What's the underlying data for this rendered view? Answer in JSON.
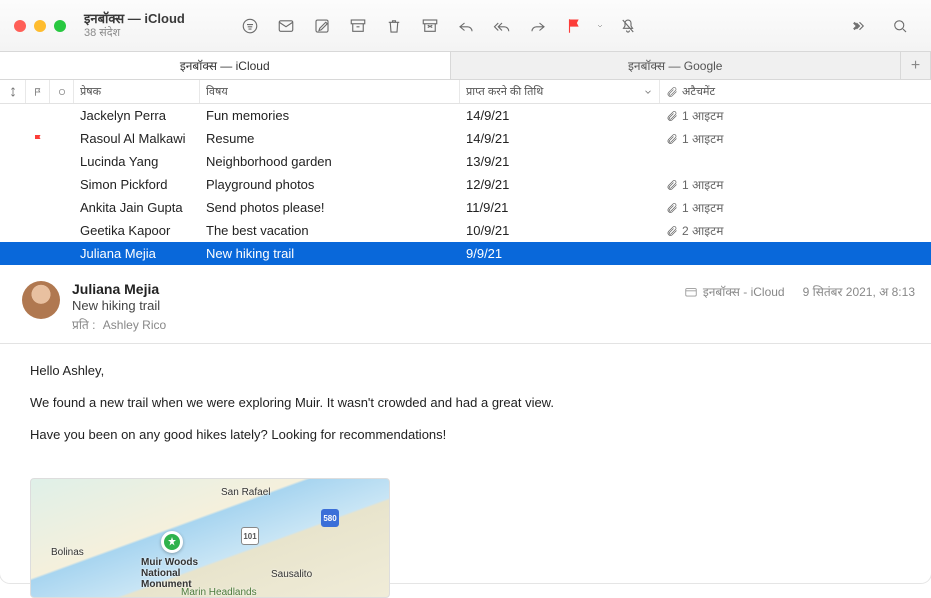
{
  "window": {
    "title": "इनबॉक्स — iCloud",
    "subtitle": "38 संदेश"
  },
  "tabs": [
    {
      "label": "इनबॉक्स — iCloud",
      "active": true
    },
    {
      "label": "इनबॉक्स — Google",
      "active": false
    }
  ],
  "columns": {
    "sender": "प्रेषक",
    "subject": "विषय",
    "date": "प्राप्त करने की तिथि",
    "attachment": "अटैचमेंट"
  },
  "messages": [
    {
      "flag": false,
      "sender": "Jackelyn Perra",
      "subject": "Fun memories",
      "date": "14/9/21",
      "attach": "1 आइटम"
    },
    {
      "flag": true,
      "sender": "Rasoul Al Malkawi",
      "subject": "Resume",
      "date": "14/9/21",
      "attach": "1 आइटम"
    },
    {
      "flag": false,
      "sender": "Lucinda Yang",
      "subject": "Neighborhood garden",
      "date": "13/9/21",
      "attach": ""
    },
    {
      "flag": false,
      "sender": "Simon Pickford",
      "subject": "Playground photos",
      "date": "12/9/21",
      "attach": "1 आइटम"
    },
    {
      "flag": false,
      "sender": "Ankita Jain Gupta",
      "subject": "Send photos please!",
      "date": "11/9/21",
      "attach": "1 आइटम"
    },
    {
      "flag": false,
      "sender": "Geetika Kapoor",
      "subject": "The best vacation",
      "date": "10/9/21",
      "attach": "2 आइटम"
    },
    {
      "flag": false,
      "sender": "Juliana Mejia",
      "subject": "New hiking trail",
      "date": "9/9/21",
      "attach": "",
      "selected": true
    }
  ],
  "preview": {
    "from": "Juliana Mejia",
    "subject": "New hiking trail",
    "to_label": "प्रति :",
    "to": "Ashley Rico",
    "mailbox": "इनबॉक्स - iCloud",
    "datetime": "9 सितंबर 2021, अ 8:13",
    "body": [
      "Hello Ashley,",
      "We found a new trail when we were exploring Muir. It wasn't crowded and had a great view.",
      "Have you been on any good hikes lately? Looking for recommendations!"
    ],
    "map": {
      "places": [
        "San Rafael",
        "Bolinas",
        "Muir Woods National Monument",
        "Sausalito",
        "Marin Headlands"
      ],
      "roads": [
        "101",
        "580"
      ]
    }
  }
}
